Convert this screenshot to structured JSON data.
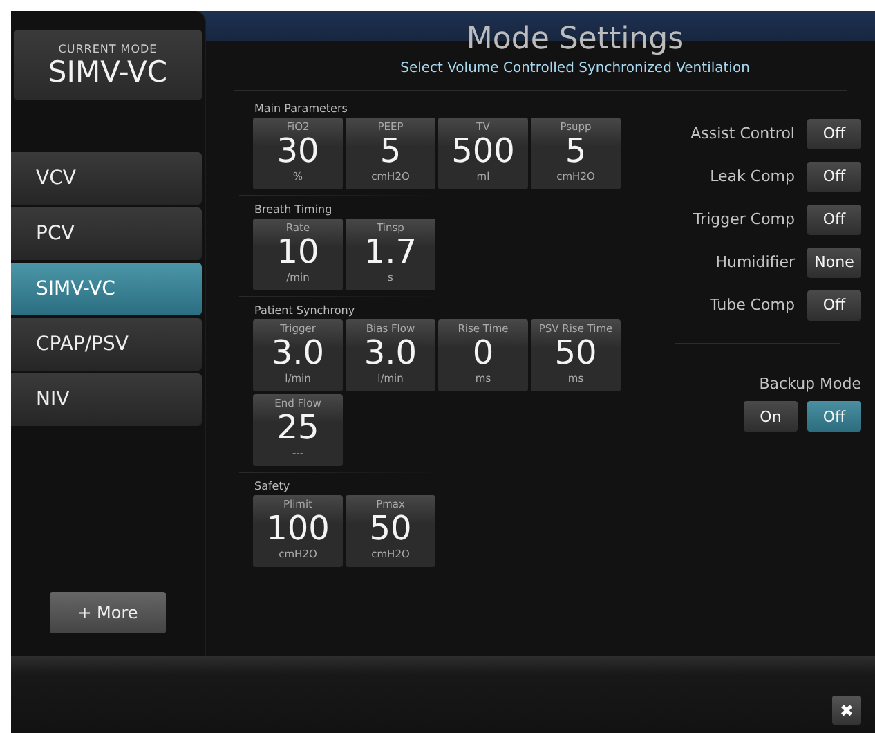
{
  "current_mode": {
    "label": "CURRENT MODE",
    "value": "SIMV-VC"
  },
  "modes": [
    {
      "label": "VCV",
      "selected": false
    },
    {
      "label": "PCV",
      "selected": false
    },
    {
      "label": "SIMV-VC",
      "selected": true
    },
    {
      "label": "CPAP/PSV",
      "selected": false
    },
    {
      "label": "NIV",
      "selected": false
    }
  ],
  "more_button": "+ More",
  "title": "Mode Settings",
  "subtitle": "Select Volume Controlled Synchronized Ventilation",
  "sections": [
    {
      "title": "Main Parameters",
      "params": [
        {
          "name": "FiO2",
          "value": "30",
          "unit": "%"
        },
        {
          "name": "PEEP",
          "value": "5",
          "unit": "cmH2O"
        },
        {
          "name": "TV",
          "value": "500",
          "unit": "ml"
        },
        {
          "name": "Psupp",
          "value": "5",
          "unit": "cmH2O"
        }
      ]
    },
    {
      "title": "Breath Timing",
      "params": [
        {
          "name": "Rate",
          "value": "10",
          "unit": "/min"
        },
        {
          "name": "Tinsp",
          "value": "1.7",
          "unit": "s"
        }
      ]
    },
    {
      "title": "Patient Synchrony",
      "params": [
        {
          "name": "Trigger",
          "value": "3.0",
          "unit": "l/min"
        },
        {
          "name": "Bias Flow",
          "value": "3.0",
          "unit": "l/min"
        },
        {
          "name": "Rise Time",
          "value": "0",
          "unit": "ms"
        },
        {
          "name": "PSV Rise Time",
          "value": "50",
          "unit": "ms"
        },
        {
          "name": "End Flow",
          "value": "25",
          "unit": "---"
        }
      ]
    },
    {
      "title": "Safety",
      "params": [
        {
          "name": "Plimit",
          "value": "100",
          "unit": "cmH2O"
        },
        {
          "name": "Pmax",
          "value": "50",
          "unit": "cmH2O"
        }
      ]
    }
  ],
  "options": [
    {
      "label": "Assist Control",
      "value": "Off"
    },
    {
      "label": "Leak Comp",
      "value": "Off"
    },
    {
      "label": "Trigger Comp",
      "value": "Off"
    },
    {
      "label": "Humidifier",
      "value": "None"
    },
    {
      "label": "Tube Comp",
      "value": "Off"
    }
  ],
  "backup_mode": {
    "label": "Backup Mode",
    "choices": [
      {
        "label": "On",
        "selected": false
      },
      {
        "label": "Off",
        "selected": true
      }
    ]
  },
  "close_button": "✖"
}
